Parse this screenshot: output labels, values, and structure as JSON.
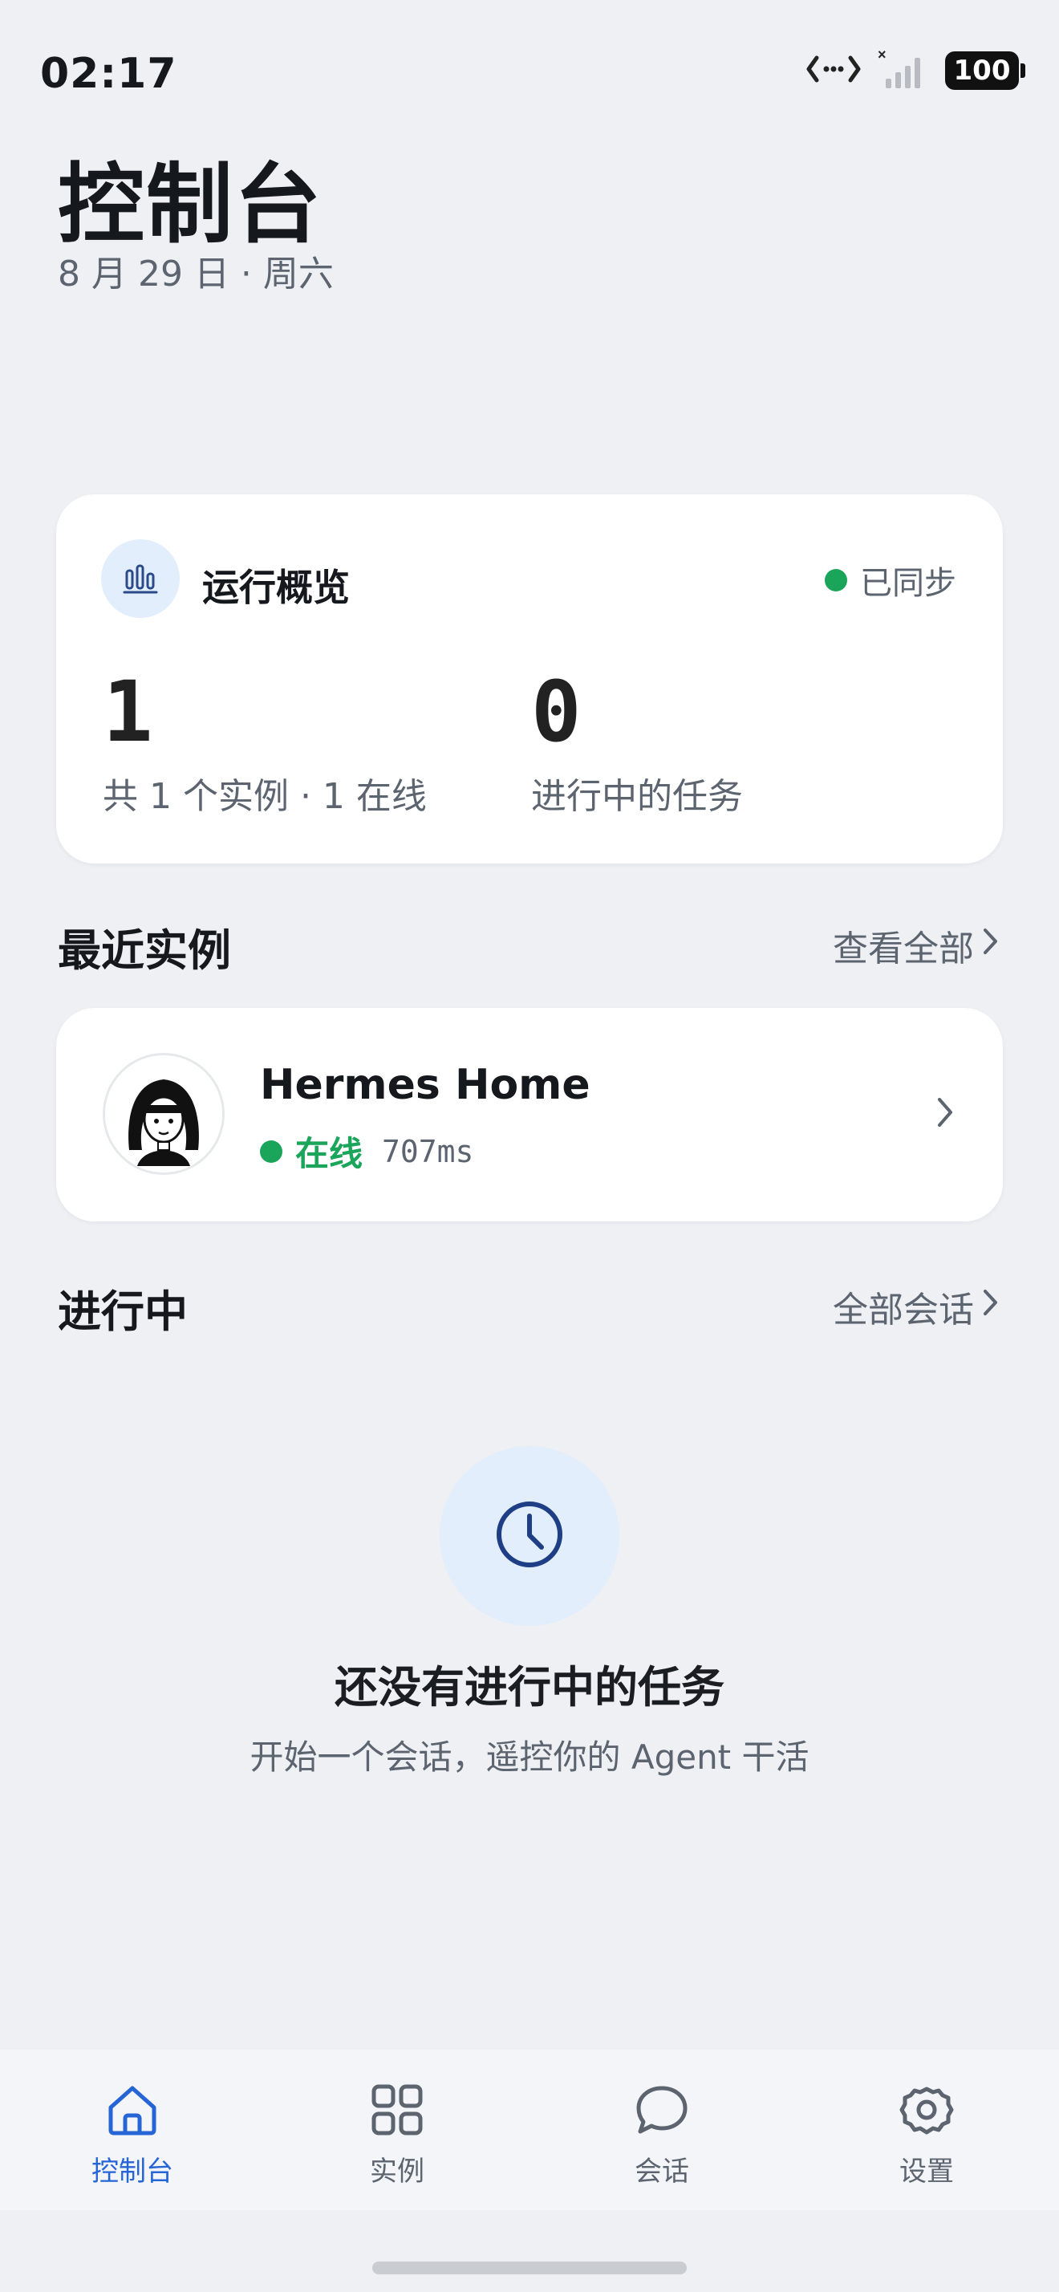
{
  "status_bar": {
    "time": "02:17",
    "battery": "100",
    "icons": [
      "data-transfer-icon",
      "signal-icon",
      "battery-icon"
    ]
  },
  "header": {
    "title": "控制台",
    "date": "8 月 29 日 · 周六"
  },
  "overview": {
    "title": "运行概览",
    "icon": "bar-chart-icon",
    "sync_status": "已同步",
    "sync_color": "#1ba55a",
    "stats": [
      {
        "value": "1",
        "label": "共 1 个实例 · 1 在线"
      },
      {
        "value": "0",
        "label": "进行中的任务"
      }
    ]
  },
  "recent_instances": {
    "title": "最近实例",
    "link": "查看全部",
    "items": [
      {
        "name": "Hermes Home",
        "status": "在线",
        "latency": "707ms",
        "status_color": "#1ba55a"
      }
    ]
  },
  "in_progress": {
    "title": "进行中",
    "link": "全部会话",
    "empty_icon": "clock-icon",
    "empty_title": "还没有进行中的任务",
    "empty_subtitle": "开始一个会话，遥控你的 Agent 干活"
  },
  "nav": {
    "active_color": "#2565d6",
    "items": [
      {
        "label": "控制台",
        "icon": "home-icon",
        "active": true
      },
      {
        "label": "实例",
        "icon": "grid-icon",
        "active": false
      },
      {
        "label": "会话",
        "icon": "chat-bubble-icon",
        "active": false
      },
      {
        "label": "设置",
        "icon": "gear-icon",
        "active": false
      }
    ]
  }
}
